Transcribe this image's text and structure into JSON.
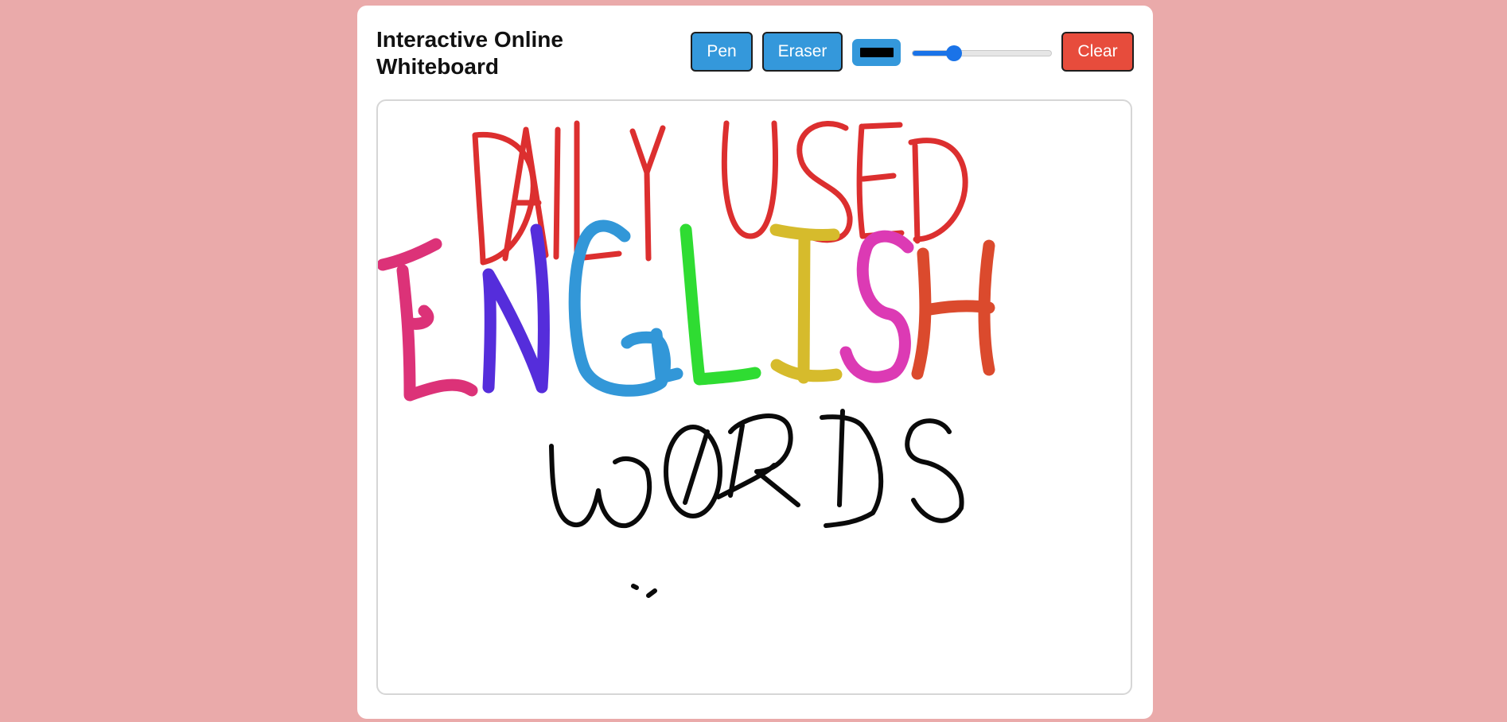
{
  "app": {
    "title": "Interactive Online Whiteboard"
  },
  "toolbar": {
    "pen_label": "Pen",
    "eraser_label": "Eraser",
    "clear_label": "Clear",
    "color_value": "#000000",
    "size_slider_fraction": 0.3
  },
  "colors": {
    "background": "#eaaaaa",
    "primary_button": "#3498db",
    "danger_button": "#e74c3c",
    "slider_accent": "#1a73e8"
  },
  "drawing": {
    "handwritten_lines": [
      "DAILY USED",
      "ENGLISH",
      "WORDS"
    ],
    "stroke_colors": {
      "daily_used": "#dc2f2f",
      "E": "#dc3278",
      "N": "#552ddb",
      "G": "#3297d8",
      "L": "#2fdc32",
      "I": "#d6bb2c",
      "S": "#dc3ab4",
      "H": "#db4a2d",
      "words": "#0a0a0a"
    }
  }
}
